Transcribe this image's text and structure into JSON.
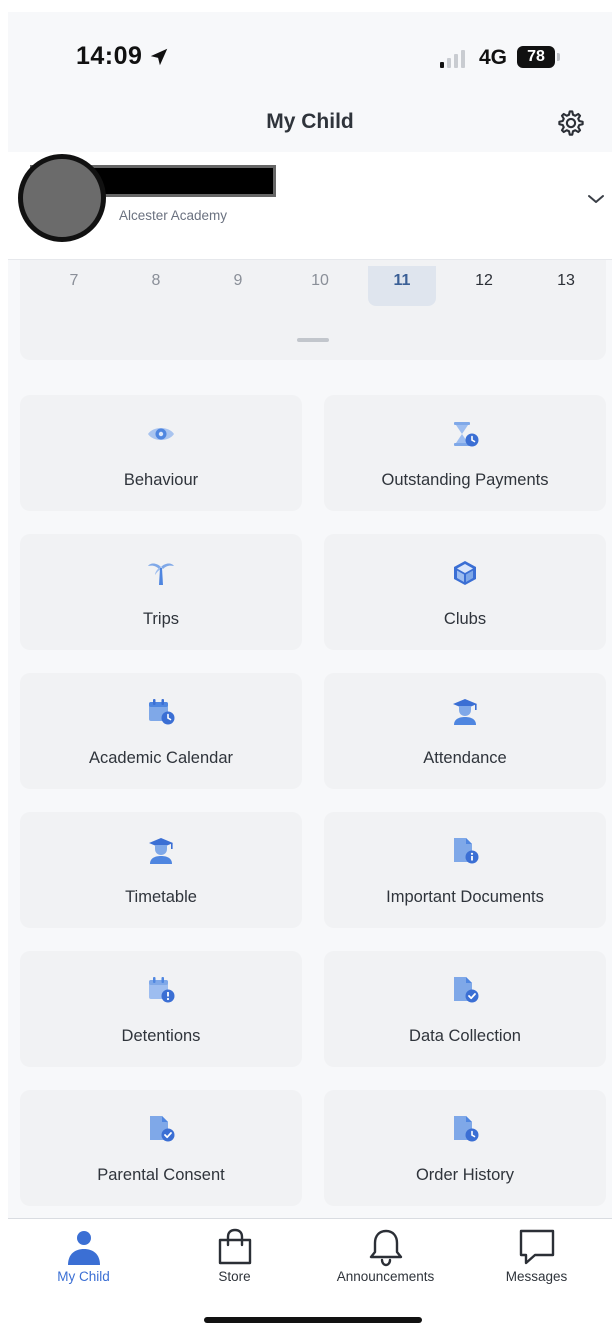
{
  "status_bar": {
    "time": "14:09",
    "network": "4G",
    "battery": "78",
    "icons": [
      "location-arrow-icon",
      "cellular-signal-icon",
      "battery-icon"
    ]
  },
  "header": {
    "title": "My Child",
    "settings_icon": "gear-icon"
  },
  "child": {
    "school": "Alcester Academy",
    "chevron_icon": "chevron-down-icon"
  },
  "week": {
    "days": [
      "7",
      "8",
      "9",
      "10",
      "11",
      "12",
      "13"
    ],
    "selected": "11"
  },
  "tiles": [
    {
      "label": "Behaviour",
      "icon": "eye-icon"
    },
    {
      "label": "Outstanding Payments",
      "icon": "hourglass-clock-icon"
    },
    {
      "label": "Trips",
      "icon": "palm-tree-icon"
    },
    {
      "label": "Clubs",
      "icon": "cube-icon"
    },
    {
      "label": "Academic Calendar",
      "icon": "calendar-clock-icon"
    },
    {
      "label": "Attendance",
      "icon": "graduate-icon"
    },
    {
      "label": "Timetable",
      "icon": "graduate-icon"
    },
    {
      "label": "Important Documents",
      "icon": "document-info-icon"
    },
    {
      "label": "Detentions",
      "icon": "calendar-alert-icon"
    },
    {
      "label": "Data Collection",
      "icon": "document-check-icon"
    },
    {
      "label": "Parental Consent",
      "icon": "document-check-icon"
    },
    {
      "label": "Order History",
      "icon": "document-clock-icon"
    }
  ],
  "tabbar": {
    "items": [
      {
        "label": "My Child",
        "icon": "person-icon",
        "active": true
      },
      {
        "label": "Store",
        "icon": "shopping-bag-icon",
        "active": false
      },
      {
        "label": "Announcements",
        "icon": "bell-icon",
        "active": false
      },
      {
        "label": "Messages",
        "icon": "chat-bubble-icon",
        "active": false
      }
    ]
  },
  "colors": {
    "accent": "#3b6fd4",
    "icon_blue": "#4f86e0",
    "icon_light": "#7fa8e8",
    "tile_bg": "#f1f2f4",
    "selected_day_bg": "#dfe5ee"
  }
}
